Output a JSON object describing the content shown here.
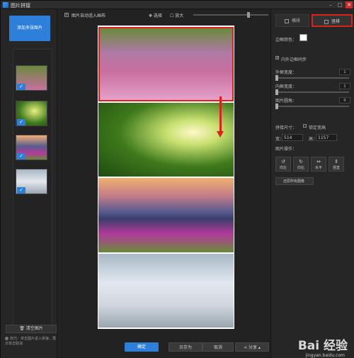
{
  "window": {
    "title": "图片拼接",
    "min": "–",
    "max": "□",
    "close": "✕"
  },
  "left": {
    "add_label": "添加多张图片",
    "clear_label": "清空图片",
    "tip": "技巧：单击图片进入拼接，再次单击取消"
  },
  "toolbar": {
    "auto_label": "图片自动适入画布",
    "auto_checked": "✓",
    "select_label": "选择",
    "zoom_label": "放大"
  },
  "bottom": {
    "ok": "确定",
    "save_as": "另存为",
    "cancel": "取消",
    "share": "分享"
  },
  "right": {
    "tab_horizontal": "横排",
    "tab_vertical": "竖排",
    "border_color_label": "边框颜色：",
    "sync_label": "内外边框同步",
    "sync_checked": "✓",
    "outer_label": "外框宽度：",
    "outer_value": "1",
    "inner_label": "内框宽度：",
    "inner_value": "1",
    "radius_label": "图片圆角：",
    "radius_value": "0",
    "size_label": "拼接尺寸：",
    "lock_label": "锁定宽高",
    "width_label": "宽：",
    "width_value": "514",
    "height_label": "高：",
    "height_value": "1157",
    "ops_label": "图片操作：",
    "ops": [
      "向左",
      "向右",
      "水平",
      "竖直"
    ],
    "restore_label": "还原所有图像"
  },
  "watermark": {
    "main": "Bai 经验",
    "sub": "jingyan.baidu.com"
  }
}
